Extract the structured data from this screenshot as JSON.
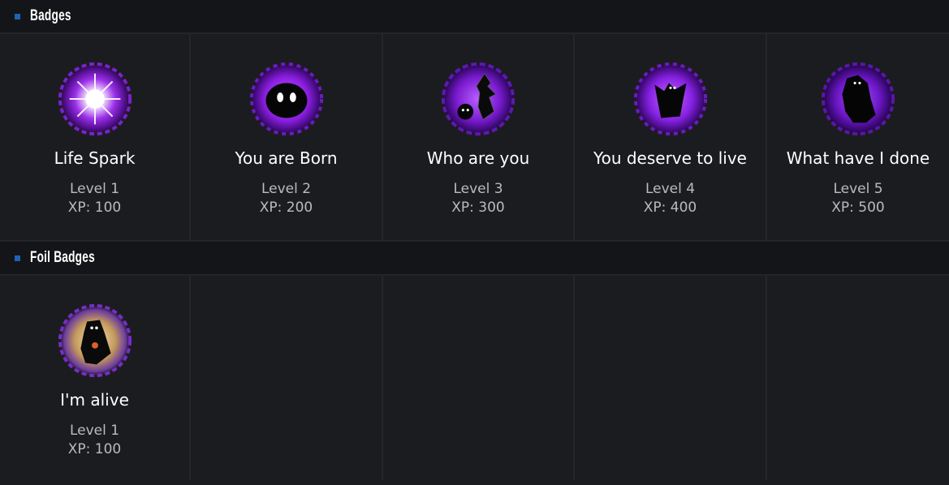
{
  "sections": [
    {
      "title": "Badges",
      "badges": [
        {
          "name": "Life Spark",
          "level": "Level 1",
          "xp": "XP: 100",
          "icon": "life-spark-badge-icon"
        },
        {
          "name": "You are Born",
          "level": "Level 2",
          "xp": "XP: 200",
          "icon": "blob-creature-badge-icon"
        },
        {
          "name": "Who are you",
          "level": "Level 3",
          "xp": "XP: 300",
          "icon": "shadow-figure-badge-icon"
        },
        {
          "name": "You deserve to live",
          "level": "Level 4",
          "xp": "XP: 400",
          "icon": "winged-creature-badge-icon"
        },
        {
          "name": "What have I done",
          "level": "Level 5",
          "xp": "XP: 500",
          "icon": "dark-figure-badge-icon"
        }
      ]
    },
    {
      "title": "Foil Badges",
      "badges": [
        {
          "name": "I'm alive",
          "level": "Level 1",
          "xp": "XP: 100",
          "icon": "foil-hooded-figure-badge-icon"
        }
      ]
    }
  ],
  "colors": {
    "accent": "#1e63b5",
    "badge_glow": "#8a2be2",
    "foil_glow": "#c49a5a"
  }
}
